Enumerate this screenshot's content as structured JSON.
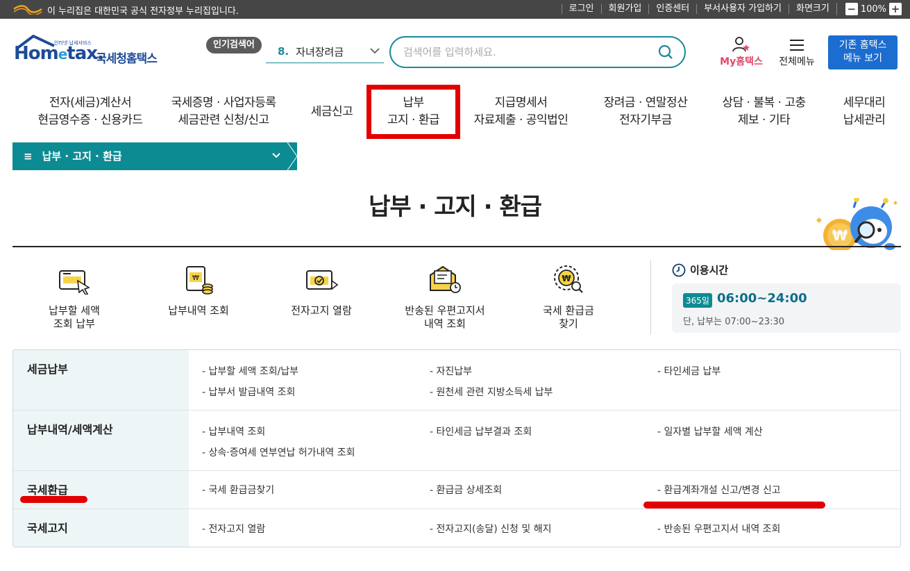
{
  "govbar": {
    "notice": "이 누리집은 대한민국 공식 전자정부 누리집입니다.",
    "links": [
      "로그인",
      "회원가입",
      "인증센터",
      "부서사용자 가입하기",
      "화면크기"
    ],
    "zoom_minus": "−",
    "zoom_value": "100%",
    "zoom_plus": "+"
  },
  "logo": {
    "brand_en": "Hom",
    "brand_e": "e",
    "brand_en2": "tax.",
    "tagline": "인터넷 납세서비스",
    "brand_ko": "국세청홈택스"
  },
  "search": {
    "popular_label": "인기검색어",
    "popular_rank": "8.",
    "popular_term": "자녀장려금",
    "placeholder": "검색어를 입력하세요."
  },
  "header_right": {
    "my_hometax": "My홈택스",
    "all_menu": "전체메뉴",
    "classic_line1": "기존 홈택스",
    "classic_line2": "메뉴 보기"
  },
  "gnb": [
    {
      "line1": "전자(세금)계산서",
      "line2": "현금영수증 · 신용카드"
    },
    {
      "line1": "국세증명 · 사업자등록",
      "line2": "세금관련 신청/신고"
    },
    {
      "line1": "세금신고",
      "line2": ""
    },
    {
      "line1": "납부",
      "line2": "고지 · 환급"
    },
    {
      "line1": "지급명세서",
      "line2": "자료제출 · 공익법인"
    },
    {
      "line1": "장려금 · 연말정산",
      "line2": "전자기부금"
    },
    {
      "line1": "상담 · 불복 · 고충",
      "line2": "제보 · 기타"
    },
    {
      "line1": "세무대리",
      "line2": "납세관리"
    }
  ],
  "breadcrumb": "납부 · 고지 · 환급",
  "page_title": "납부 · 고지 · 환급",
  "quick": [
    {
      "line1": "납부할 세액",
      "line2": "조회 납부",
      "icon": "tax-payment-icon"
    },
    {
      "line1": "납부내역 조회",
      "line2": "",
      "icon": "payment-history-icon"
    },
    {
      "line1": "전자고지 열람",
      "line2": "",
      "icon": "e-notice-icon"
    },
    {
      "line1": "반송된 우편고지서",
      "line2": "내역 조회",
      "icon": "returned-mail-icon"
    },
    {
      "line1": "국세 환급금",
      "line2": "찾기",
      "icon": "refund-search-icon"
    }
  ],
  "hours": {
    "title": "이용시간",
    "badge": "365일",
    "time": "06:00~24:00",
    "note": "단, 납부는 07:00~23:30"
  },
  "menu_table": [
    {
      "category": "세금납부",
      "links": [
        "납부할 세액 조회/납부",
        "자진납부",
        "타인세금 납부",
        "납부서 발급내역 조회",
        "원천세 관련 지방소득세 납부"
      ]
    },
    {
      "category": "납부내역/세액계산",
      "links": [
        "납부내역 조회",
        "타인세금 납부결과 조회",
        "일자별 납부할 세액 계산",
        "상속·증여세 연부연납 허가내역 조회"
      ]
    },
    {
      "category": "국세환급",
      "links": [
        "국세 환급금찾기",
        "환급금 상세조회",
        "환급계좌개설 신고/변경 신고"
      ]
    },
    {
      "category": "국세고지",
      "links": [
        "전자고지 열람",
        "전자고지(송달) 신청 및 해지",
        "반송된 우편고지서 내역 조회"
      ]
    }
  ],
  "link_prefix": "- ",
  "colors": {
    "teal": "#0d8b93",
    "highlight_red": "#e20000",
    "brand_blue": "#1d4b97",
    "classic_btn": "#1b6dd0"
  }
}
